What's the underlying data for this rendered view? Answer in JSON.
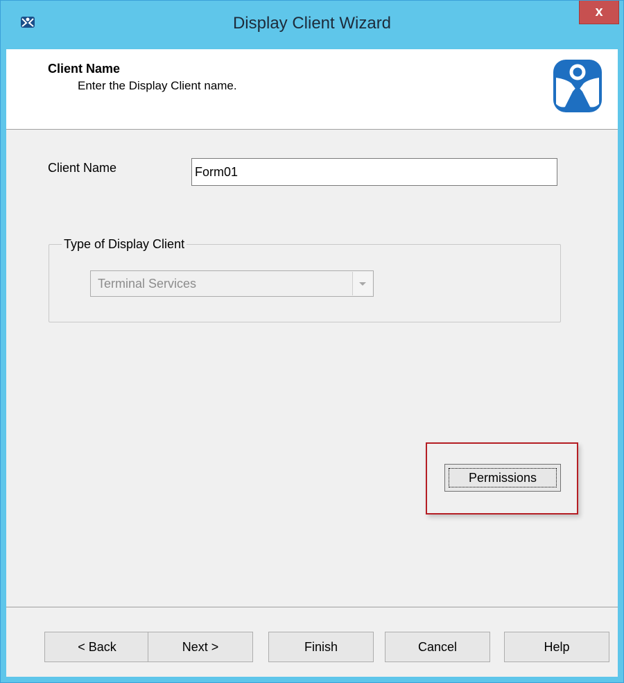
{
  "window": {
    "title": "Display Client Wizard",
    "close_label": "x",
    "app_icon": "thinmanager-icon",
    "titlebar_color": "#5fc6ea"
  },
  "header": {
    "title": "Client Name",
    "subtitle": "Enter the Display Client name.",
    "logo_icon": "thinmanager-logo-icon",
    "logo_color": "#1e6fc1"
  },
  "form": {
    "client_name_label": "Client Name",
    "client_name_value": "Form01",
    "group_label": "Type of Display Client",
    "client_type_value": "Terminal Services",
    "permissions_label": "Permissions",
    "highlight_color": "#b51e24"
  },
  "footer": {
    "back": "< Back",
    "next": "Next >",
    "finish": "Finish",
    "cancel": "Cancel",
    "help": "Help"
  }
}
